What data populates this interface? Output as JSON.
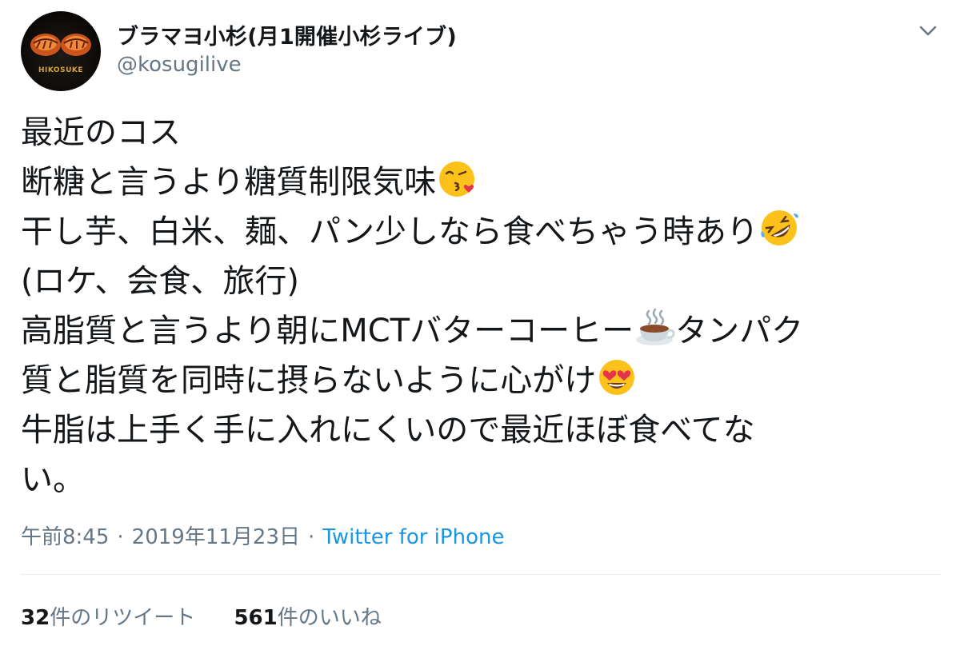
{
  "author": {
    "display_name": "ブラマヨ小杉(月1開催小杉ライブ)",
    "handle": "@kosugilive",
    "avatar_text": "HIKOSUKE"
  },
  "tweet": {
    "lines": [
      "最近のコス",
      "断糖と言うより糖質制限気味",
      "干し芋、白米、麺、パン少しなら食べちゃう時あり",
      "(ロケ、会食、旅行)",
      "高脂質と言うより朝にMCTバターコーヒー",
      "タンパク",
      "質と脂質を同時に摂らないように心がけ",
      "牛脂は上手く手に入れにくいので最近ほぼ食べてな",
      "い。"
    ],
    "emojis": {
      "kiss": "face-blowing-kiss-emoji",
      "laugh": "rolling-on-floor-laughing-emoji",
      "coffee": "hot-beverage-emoji",
      "hearts": "heart-eyes-emoji"
    }
  },
  "meta": {
    "time": "午前8:45",
    "date": "2019年11月23日",
    "separator": "·",
    "source": "Twitter for iPhone"
  },
  "stats": {
    "retweets_count": "32",
    "retweets_label": "件のリツイート",
    "likes_count": "561",
    "likes_label": "件のいいね"
  },
  "colors": {
    "text": "#14171a",
    "secondary": "#657786",
    "link": "#1b95e0",
    "divider": "#e6ecf0"
  }
}
